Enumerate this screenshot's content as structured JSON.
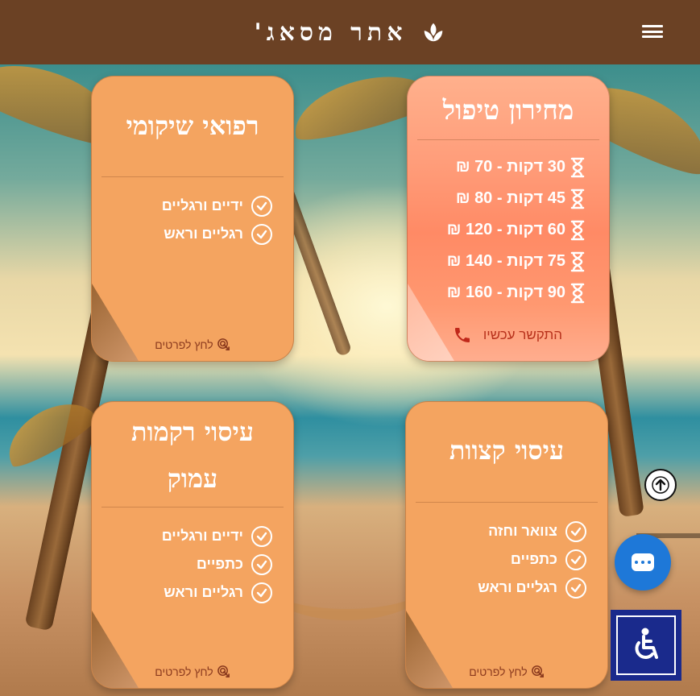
{
  "header": {
    "title": "אתר מסאג'",
    "logo_icon": "spa-leaf-icon",
    "menu_icon": "hamburger-menu-icon"
  },
  "cards": {
    "pricing": {
      "title": "מחירון טיפול",
      "items": [
        "30 דקות - 70 ₪",
        "45 דקות - 80 ₪",
        "60 דקות - 120 ₪",
        "75 דקות - 140 ₪",
        "90 דקות - 160 ₪"
      ],
      "call_label": "התקשר עכשיו"
    },
    "rehab": {
      "title": "רפואי שיקומי",
      "items": [
        "ידיים ורגליים",
        "רגליים וראש"
      ],
      "details_label": "לחץ לפרטים"
    },
    "short": {
      "title": "עיסוי קצוות",
      "items": [
        "צוואר וחזה",
        "כתפיים",
        "רגליים וראש"
      ],
      "details_label": "לחץ לפרטים"
    },
    "deep": {
      "title": "עיסוי רקמות עמוק",
      "items": [
        "ידיים ורגליים",
        "כתפיים",
        "רגליים וראש"
      ],
      "details_label": "לחץ לפרטים"
    }
  },
  "colors": {
    "header_bg": "#6b4124",
    "card_bg": "#f4a460",
    "pricing_bg": "#ff9d7a",
    "chat_blue": "#1e78d8",
    "a11y_blue": "#1a2a8c"
  }
}
